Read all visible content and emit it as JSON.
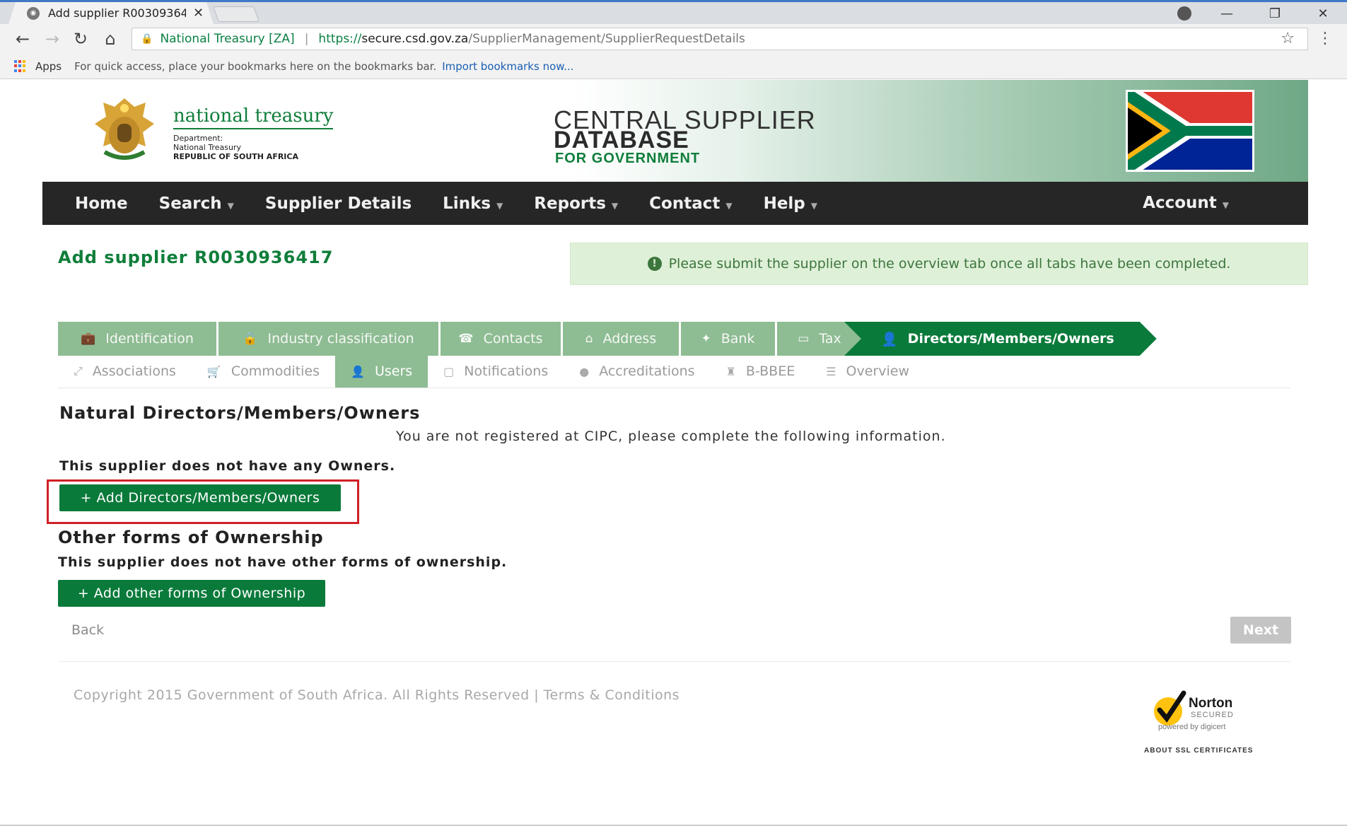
{
  "browser": {
    "tab_title": "Add supplier R00309364",
    "secure_label": "National Treasury [ZA]",
    "url_scheme": "https://",
    "url_host": "secure.csd.gov.za",
    "url_path": "/SupplierManagement/SupplierRequestDetails",
    "bookmarks_apps": "Apps",
    "bookmarks_hint": "For quick access, place your bookmarks here on the bookmarks bar.",
    "bookmarks_import": "Import bookmarks now...",
    "win_minimize": "—",
    "win_restore": "❐",
    "win_close": "✕"
  },
  "header": {
    "org_name": "national treasury",
    "dept_line1": "Department:",
    "dept_line2": "National Treasury",
    "dept_line3": "REPUBLIC OF SOUTH AFRICA",
    "csd_line1": "CENTRAL SUPPLIER",
    "csd_line2": "DATABASE",
    "csd_line3": "FOR GOVERNMENT"
  },
  "nav": {
    "home": "Home",
    "search": "Search",
    "supplier_details": "Supplier Details",
    "links": "Links",
    "reports": "Reports",
    "contact": "Contact",
    "help": "Help",
    "account": "Account"
  },
  "page": {
    "title": "Add supplier R0030936417",
    "alert": "Please submit the supplier on the overview tab once all tabs have been completed."
  },
  "wizard": {
    "row1": [
      {
        "label": "Identification",
        "icon": "briefcase-icon"
      },
      {
        "label": "Industry classification",
        "icon": "lock-icon"
      },
      {
        "label": "Contacts",
        "icon": "phone-icon"
      },
      {
        "label": "Address",
        "icon": "home-icon"
      },
      {
        "label": "Bank",
        "icon": "piggy-bank-icon"
      },
      {
        "label": "Tax",
        "icon": "folder-icon"
      }
    ],
    "active": {
      "label": "Directors/Members/Owners",
      "icon": "user-icon"
    },
    "row2": [
      {
        "label": "Associations",
        "icon": "link-icon"
      },
      {
        "label": "Commodities",
        "icon": "cart-icon"
      },
      {
        "label": "Users",
        "icon": "user-icon",
        "active": true
      },
      {
        "label": "Notifications",
        "icon": "inbox-icon"
      },
      {
        "label": "Accreditations",
        "icon": "certificate-icon"
      },
      {
        "label": "B-BBEE",
        "icon": "award-icon"
      },
      {
        "label": "Overview",
        "icon": "list-icon"
      }
    ]
  },
  "content": {
    "natural_title": "Natural Directors/Members/Owners",
    "cipc_notice": "You are not registered at CIPC, please complete the following information.",
    "no_owners": "This supplier does not have any Owners.",
    "add_owners_button": "+ Add Directors/Members/Owners",
    "other_title": "Other forms of Ownership",
    "no_other": "This supplier does not have other forms of ownership.",
    "add_other_button": "+ Add other forms of Ownership",
    "back": "Back",
    "next": "Next"
  },
  "footer": {
    "copyright": "Copyright 2015 Government of South Africa. All Rights Reserved | Terms & Conditions",
    "norton_name": "Norton",
    "norton_secured": "SECURED",
    "norton_powered": "powered by digicert",
    "norton_about": "ABOUT SSL CERTIFICATES"
  },
  "colors": {
    "brand_green": "#0a7a3a",
    "step_done": "#8ebc93",
    "navbar": "#262626",
    "alert_bg": "#dff0d8",
    "highlight_red": "#d02027"
  }
}
